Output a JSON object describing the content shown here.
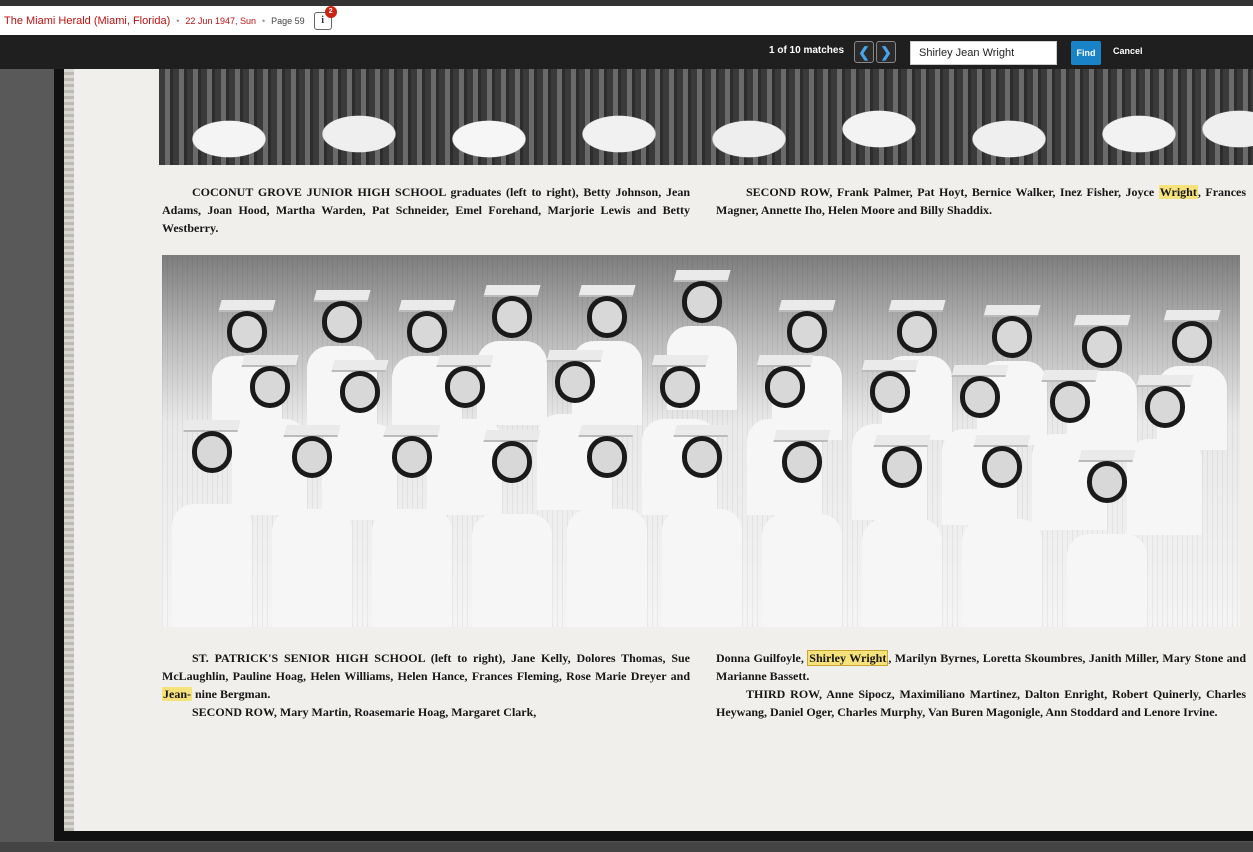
{
  "header": {
    "publication": "The Miami Herald (Miami, Florida)",
    "separator": "•",
    "date": "22 Jun 1947, Sun",
    "page": "Page 59",
    "info_icon": "i",
    "info_badge_count": "2"
  },
  "search_bar": {
    "match_count": "1 of 10 matches",
    "prev_glyph": "❮",
    "next_glyph": "❯",
    "query": "Shirley Jean Wright",
    "find_label": "Find",
    "cancel_label": "Cancel"
  },
  "article": {
    "coconut_caption": {
      "title": "COCONUT GROVE JUNIOR HIGH SCHOOL",
      "body": "graduates (left to right), Betty Johnson, Jean Adams, Joan Hood, Martha Warden, Pat Schneider, Emel Forehand, Marjorie Lewis and Betty Westberry."
    },
    "second_row_top": {
      "lead": "SECOND ROW, Frank Palmer, Pat Hoyt, Bernice Walker, Inez Fisher, Joyce",
      "highlight": "Wright",
      "tail": ", Frances Magner, Annette Iho, Helen Moore and Billy Shaddix."
    },
    "st_patricks_caption": {
      "title": "ST. PATRICK'S SENIOR HIGH SCHOOL",
      "body": "(left to right), Jane Kelly, Dolores Thomas, Sue McLaughlin, Pauline Hoag, Helen Williams, Helen Hance, Frances Fleming, Rose Marie Dreyer and",
      "highlight": "Jean-",
      "tail": "nine Bergman."
    },
    "second_row_bottom": "SECOND ROW, Mary Martin, Roasemarie Hoag, Margaret Clark,",
    "right_caption": {
      "lead": "Donna Guilfoyle,",
      "highlight": "Shirley Wright",
      "tail": ", Marilyn Byrnes, Loretta Skoumbres, Janith Miller, Mary Stone and Marianne Bassett."
    },
    "third_row": "THIRD ROW, Anne Sipocz, Maximiliano Martinez, Dalton Enright, Robert Quinerly, Charles Heywang, Daniel Oger, Charles Murphy, Van Buren Magonigle, Ann Stoddard and Lenore Irvine."
  }
}
